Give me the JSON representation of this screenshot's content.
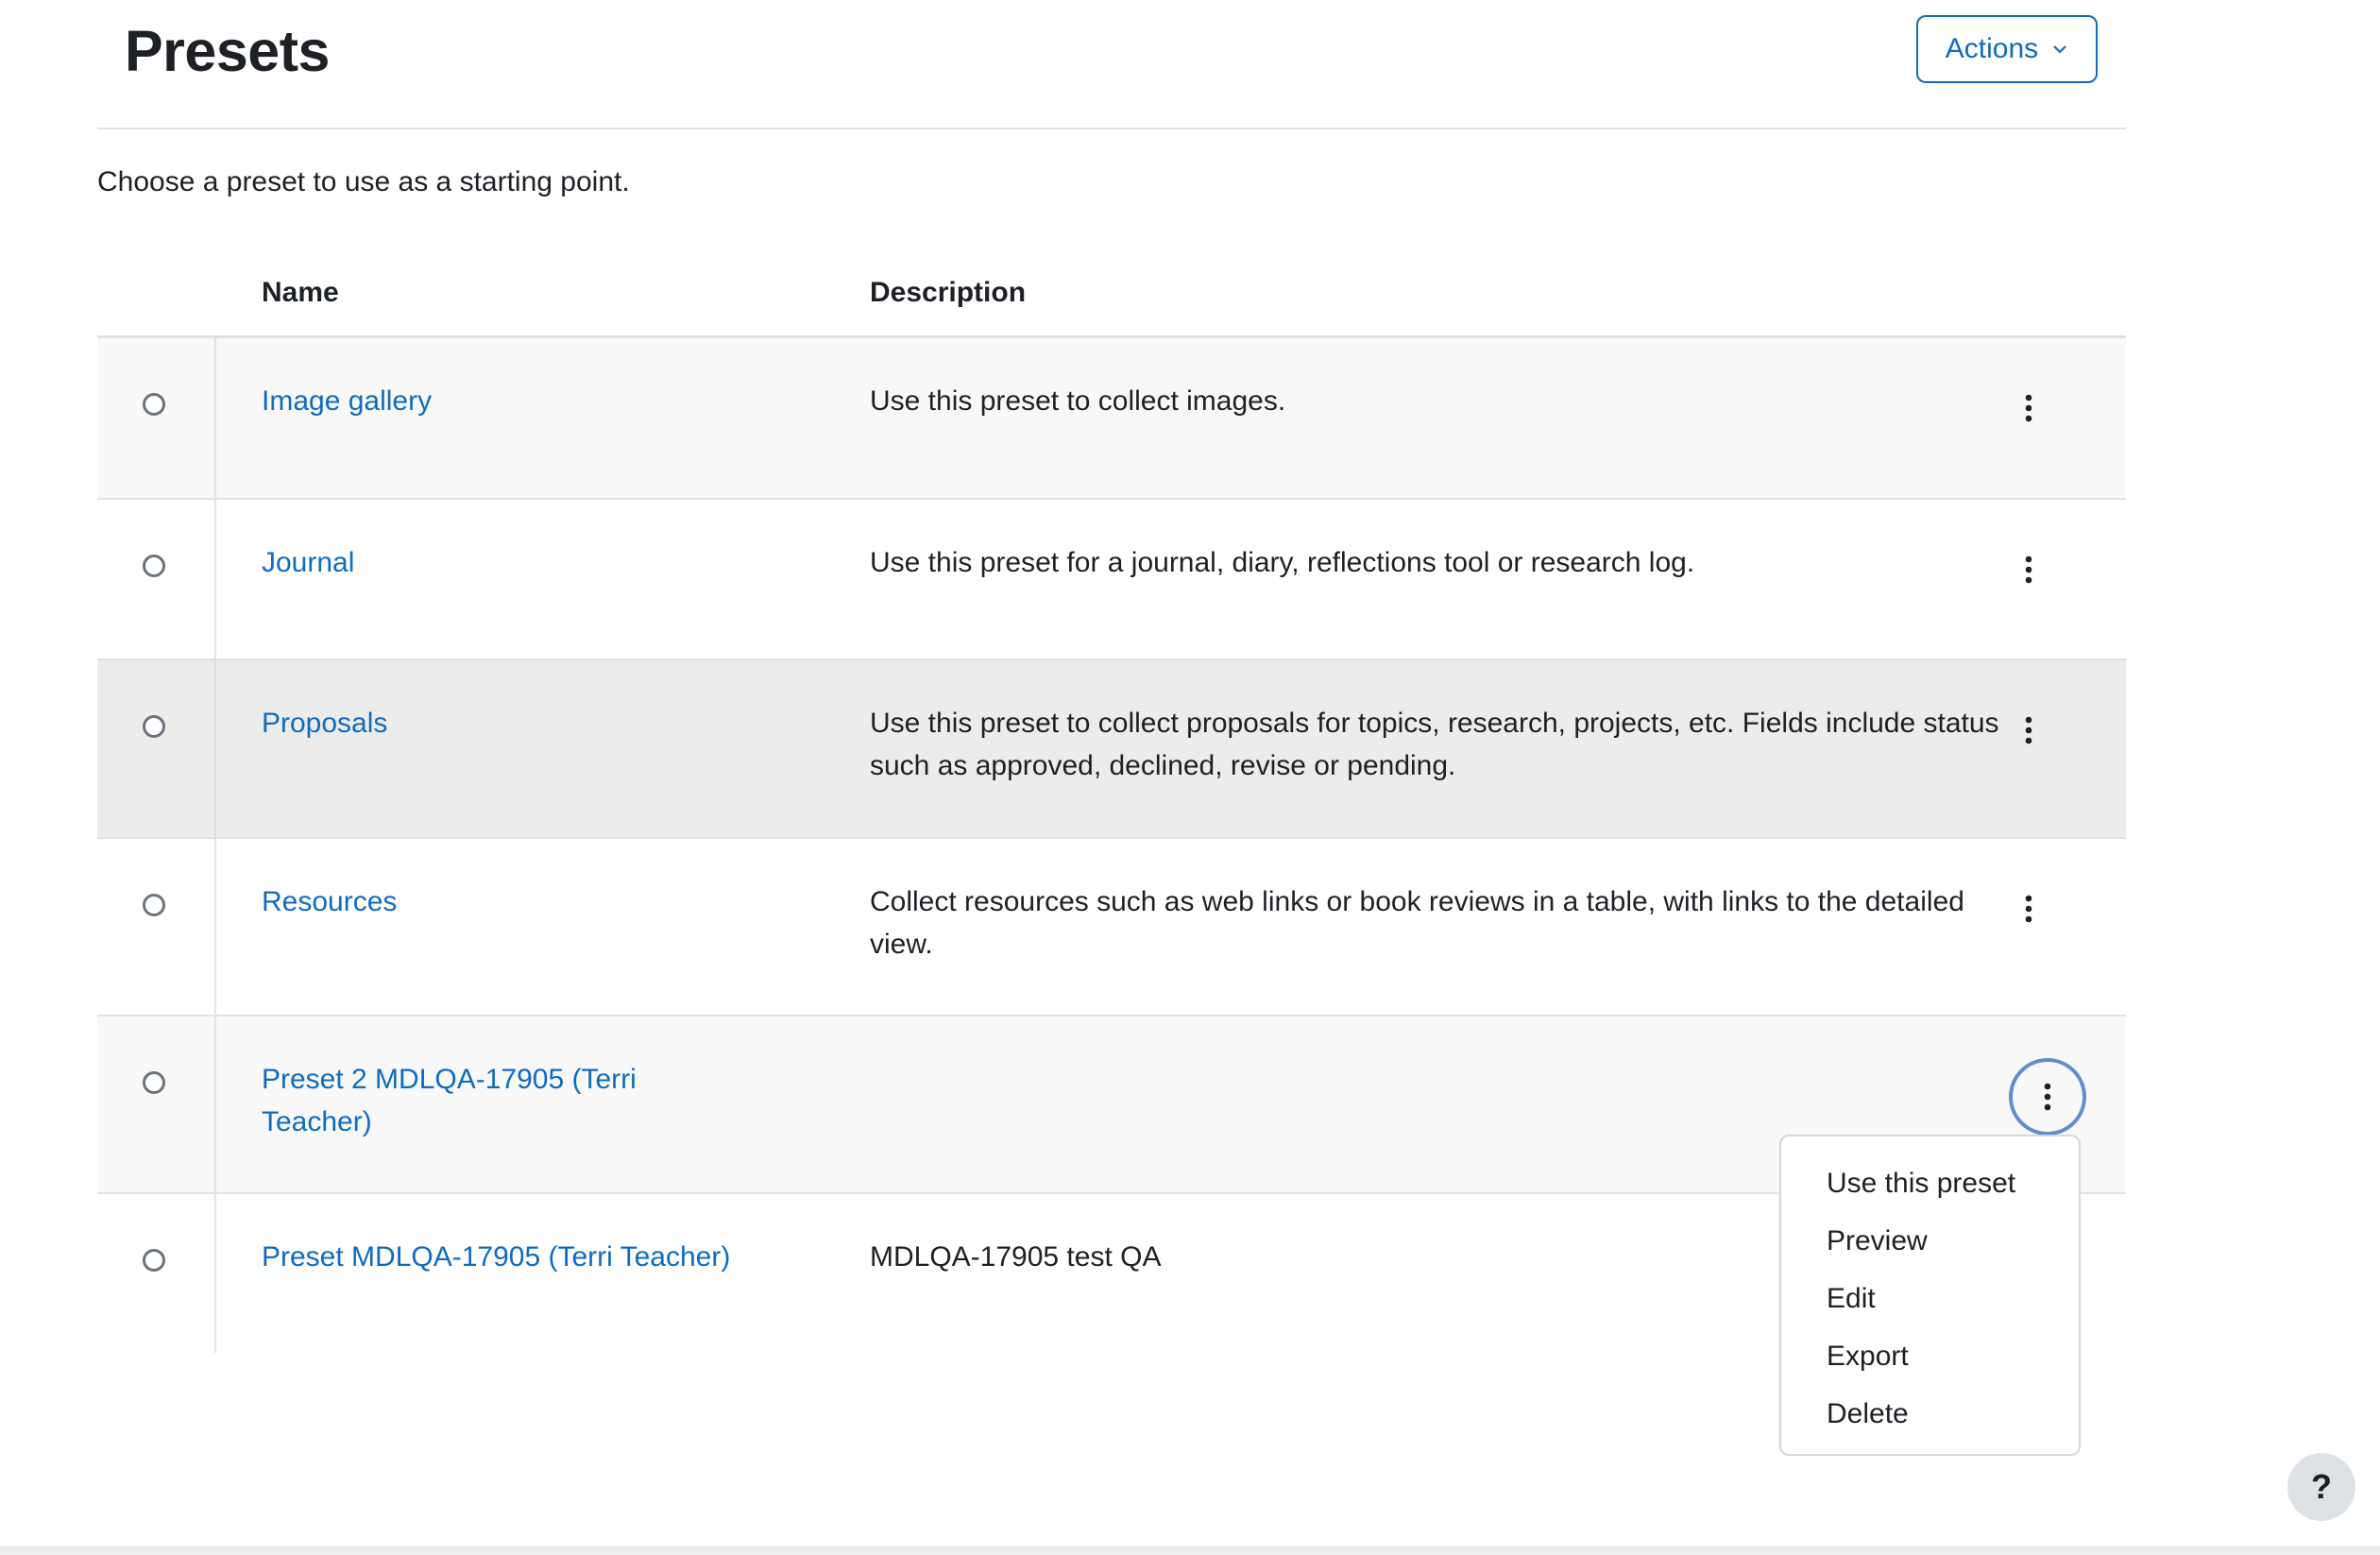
{
  "page": {
    "title": "Presets",
    "intro": "Choose a preset to use as a starting point."
  },
  "actions": {
    "label": "Actions",
    "icon": "chevron-down-icon"
  },
  "table": {
    "headers": {
      "name": "Name",
      "description": "Description"
    },
    "rows": [
      {
        "name": "Image gallery",
        "description": "Use this preset to collect images."
      },
      {
        "name": "Journal",
        "description": "Use this preset for a journal, diary, reflections tool or research log."
      },
      {
        "name": "Proposals",
        "description": "Use this preset to collect proposals for topics, research, projects, etc. Fields include status such as approved, declined, revise or pending."
      },
      {
        "name": "Resources",
        "description": "Collect resources such as web links or book reviews in a table, with links to the detailed view."
      },
      {
        "name": "Preset 2 MDLQA-17905 (Terri Teacher)",
        "description": ""
      },
      {
        "name": "Preset MDLQA-17905 (Terri Teacher)",
        "description": "MDLQA-17905 test QA"
      }
    ]
  },
  "row_menu": {
    "icon": "kebab-menu-icon",
    "items": [
      "Use this preset",
      "Preview",
      "Edit",
      "Export",
      "Delete"
    ]
  },
  "help": {
    "label": "?"
  },
  "colors": {
    "link": "#0f6cbf",
    "text": "#1d2125",
    "border": "#dee2e6",
    "row_alt": "#f8f8f8",
    "row_hover": "#ececec",
    "focus_ring": "#5f8fcf"
  }
}
